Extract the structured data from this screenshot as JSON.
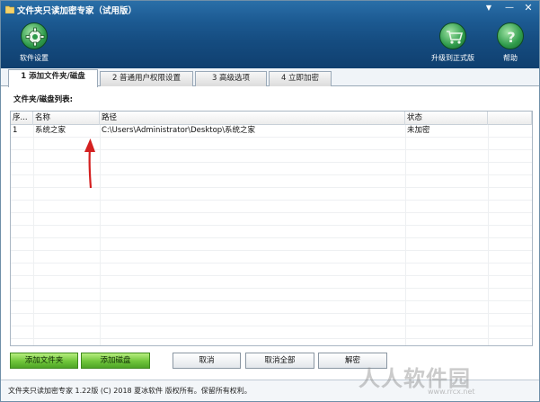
{
  "window": {
    "title": "文件夹只读加密专家（试用版）",
    "controls": {
      "menu": "▼",
      "minimize": "—",
      "close": "✕"
    }
  },
  "toolbar": {
    "settings_label": "软件设置",
    "upgrade_label": "升级到正式版",
    "help_label": "帮助",
    "icons": {
      "settings": "gear-icon",
      "upgrade": "cart-icon",
      "help": "question-icon"
    }
  },
  "tabs": [
    {
      "label": "1 添加文件夹/磁盘",
      "active": true
    },
    {
      "label": "2 普通用户权限设置",
      "active": false
    },
    {
      "label": "3 高级选项",
      "active": false
    },
    {
      "label": "4 立即加密",
      "active": false
    }
  ],
  "panel": {
    "list_label": "文件夹/磁盘列表:"
  },
  "table": {
    "columns": [
      "序...",
      "名称",
      "路径",
      "状态",
      ""
    ],
    "rows": [
      {
        "seq": "1",
        "name": "系统之家",
        "path": "C:\\Users\\Administrator\\Desktop\\系统之家",
        "status": "未加密"
      }
    ]
  },
  "buttons": {
    "add_folder": "添加文件夹",
    "add_disk": "添加磁盘",
    "cancel": "取消",
    "cancel_all": "取消全部",
    "decrypt": "解密"
  },
  "statusbar": {
    "text": "文件夹只读加密专家 1.22版 (C) 2018 夏冰软件 版权所有。保留所有权利。"
  },
  "watermark": {
    "text": "人人软件园",
    "url": "www.rrcx.net"
  },
  "colors": {
    "header": "#1c5a92",
    "accent_green": "#6fc53a",
    "arrow": "#d42020"
  }
}
